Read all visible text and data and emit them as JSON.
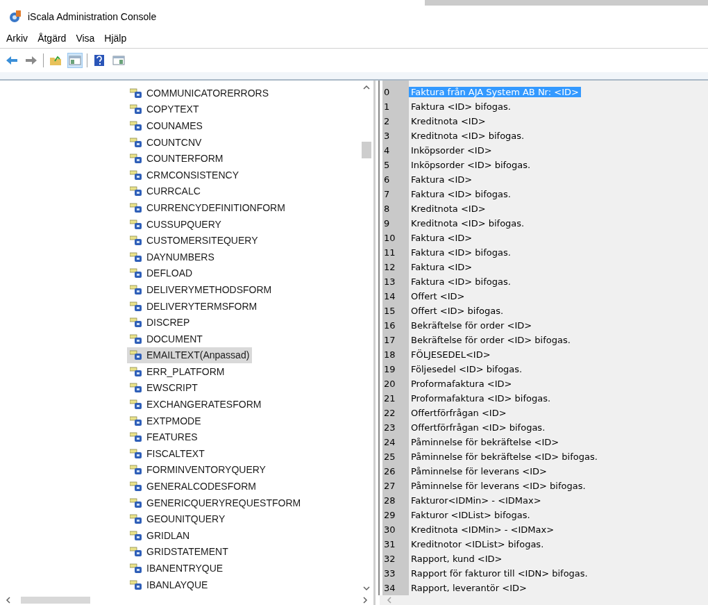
{
  "window": {
    "title": "iScala Administration Console"
  },
  "menu": [
    {
      "label": "Arkiv"
    },
    {
      "label": "Åtgärd"
    },
    {
      "label": "Visa"
    },
    {
      "label": "Hjälp"
    }
  ],
  "toolbar": [
    {
      "kind": "back",
      "pressed": false
    },
    {
      "kind": "forward",
      "pressed": false
    },
    {
      "kind": "separator"
    },
    {
      "kind": "folder-up",
      "pressed": false
    },
    {
      "kind": "tree-toggle",
      "pressed": true
    },
    {
      "kind": "separator"
    },
    {
      "kind": "help",
      "pressed": false
    },
    {
      "kind": "pane-toggle",
      "pressed": false
    }
  ],
  "tree": {
    "items": [
      {
        "label": "COMMUNICATORERRORS",
        "selected": false
      },
      {
        "label": "COPYTEXT",
        "selected": false
      },
      {
        "label": "COUNAMES",
        "selected": false
      },
      {
        "label": "COUNTCNV",
        "selected": false
      },
      {
        "label": "COUNTERFORM",
        "selected": false
      },
      {
        "label": "CRMCONSISTENCY",
        "selected": false
      },
      {
        "label": "CURRCALC",
        "selected": false
      },
      {
        "label": "CURRENCYDEFINITIONFORM",
        "selected": false
      },
      {
        "label": "CUSSUPQUERY",
        "selected": false
      },
      {
        "label": "CUSTOMERSITEQUERY",
        "selected": false
      },
      {
        "label": "DAYNUMBERS",
        "selected": false
      },
      {
        "label": "DEFLOAD",
        "selected": false
      },
      {
        "label": "DELIVERYMETHODSFORM",
        "selected": false
      },
      {
        "label": "DELIVERYTERMSFORM",
        "selected": false
      },
      {
        "label": "DISCREP",
        "selected": false
      },
      {
        "label": "DOCUMENT",
        "selected": false
      },
      {
        "label": "EMAILTEXT(Anpassad)",
        "selected": true
      },
      {
        "label": "ERR_PLATFORM",
        "selected": false
      },
      {
        "label": "EWSCRIPT",
        "selected": false
      },
      {
        "label": "EXCHANGERATESFORM",
        "selected": false
      },
      {
        "label": "EXTPMODE",
        "selected": false
      },
      {
        "label": "FEATURES",
        "selected": false
      },
      {
        "label": "FISCALTEXT",
        "selected": false
      },
      {
        "label": "FORMINVENTORYQUERY",
        "selected": false
      },
      {
        "label": "GENERALCODESFORM",
        "selected": false
      },
      {
        "label": "GENERICQUERYREQUESTFORM",
        "selected": false
      },
      {
        "label": "GEOUNITQUERY",
        "selected": false
      },
      {
        "label": "GRIDLAN",
        "selected": false
      },
      {
        "label": "GRIDSTATEMENT",
        "selected": false
      },
      {
        "label": "IBANENTRYQUE",
        "selected": false
      },
      {
        "label": "IBANLAYQUE",
        "selected": false
      }
    ]
  },
  "texts": {
    "rows": [
      {
        "number": "0",
        "text": "Faktura från AJA System AB Nr: <ID>",
        "selected": true
      },
      {
        "number": "1",
        "text": "Faktura <ID> bifogas.",
        "selected": false
      },
      {
        "number": "2",
        "text": "Kreditnota <ID>",
        "selected": false
      },
      {
        "number": "3",
        "text": "Kreditnota <ID> bifogas.",
        "selected": false
      },
      {
        "number": "4",
        "text": "Inköpsorder <ID>",
        "selected": false
      },
      {
        "number": "5",
        "text": "Inköpsorder <ID> bifogas.",
        "selected": false
      },
      {
        "number": "6",
        "text": "Faktura <ID>",
        "selected": false
      },
      {
        "number": "7",
        "text": "Faktura <ID> bifogas.",
        "selected": false
      },
      {
        "number": "8",
        "text": "Kreditnota <ID>",
        "selected": false
      },
      {
        "number": "9",
        "text": "Kreditnota <ID> bifogas.",
        "selected": false
      },
      {
        "number": "10",
        "text": "Faktura <ID>",
        "selected": false
      },
      {
        "number": "11",
        "text": "Faktura <ID> bifogas.",
        "selected": false
      },
      {
        "number": "12",
        "text": "Faktura <ID>",
        "selected": false
      },
      {
        "number": "13",
        "text": "Faktura <ID> bifogas.",
        "selected": false
      },
      {
        "number": "14",
        "text": "Offert <ID>",
        "selected": false
      },
      {
        "number": "15",
        "text": "Offert <ID> bifogas.",
        "selected": false
      },
      {
        "number": "16",
        "text": "Bekräftelse för order <ID>",
        "selected": false
      },
      {
        "number": "17",
        "text": "Bekräftelse för order <ID> bifogas.",
        "selected": false
      },
      {
        "number": "18",
        "text": "FÖLJESEDEL<ID>",
        "selected": false
      },
      {
        "number": "19",
        "text": "Följesedel <ID> bifogas.",
        "selected": false
      },
      {
        "number": "20",
        "text": "Proformafaktura <ID>",
        "selected": false
      },
      {
        "number": "21",
        "text": "Proformafaktura <ID> bifogas.",
        "selected": false
      },
      {
        "number": "22",
        "text": "Offertförfrågan <ID>",
        "selected": false
      },
      {
        "number": "23",
        "text": "Offertförfrågan <ID> bifogas.",
        "selected": false
      },
      {
        "number": "24",
        "text": "Påminnelse för bekräftelse <ID>",
        "selected": false
      },
      {
        "number": "25",
        "text": "Påminnelse för bekräftelse <ID> bifogas.",
        "selected": false
      },
      {
        "number": "26",
        "text": "Påminnelse för leverans <ID>",
        "selected": false
      },
      {
        "number": "27",
        "text": "Påminnelse för leverans <ID> bifogas.",
        "selected": false
      },
      {
        "number": "28",
        "text": "Fakturor<IDMin> - <IDMax>",
        "selected": false
      },
      {
        "number": "29",
        "text": "Fakturor <IDList> bifogas.",
        "selected": false
      },
      {
        "number": "30",
        "text": "Kreditnota <IDMin> - <IDMax>",
        "selected": false
      },
      {
        "number": "31",
        "text": "Kreditnotor <IDList> bifogas.",
        "selected": false
      },
      {
        "number": "32",
        "text": "Rapport, kund <ID>",
        "selected": false
      },
      {
        "number": "33",
        "text": "Rapport för fakturor till <IDN> bifogas.",
        "selected": false
      },
      {
        "number": "34",
        "text": "Rapport, leverantör <ID>",
        "selected": false
      }
    ]
  }
}
